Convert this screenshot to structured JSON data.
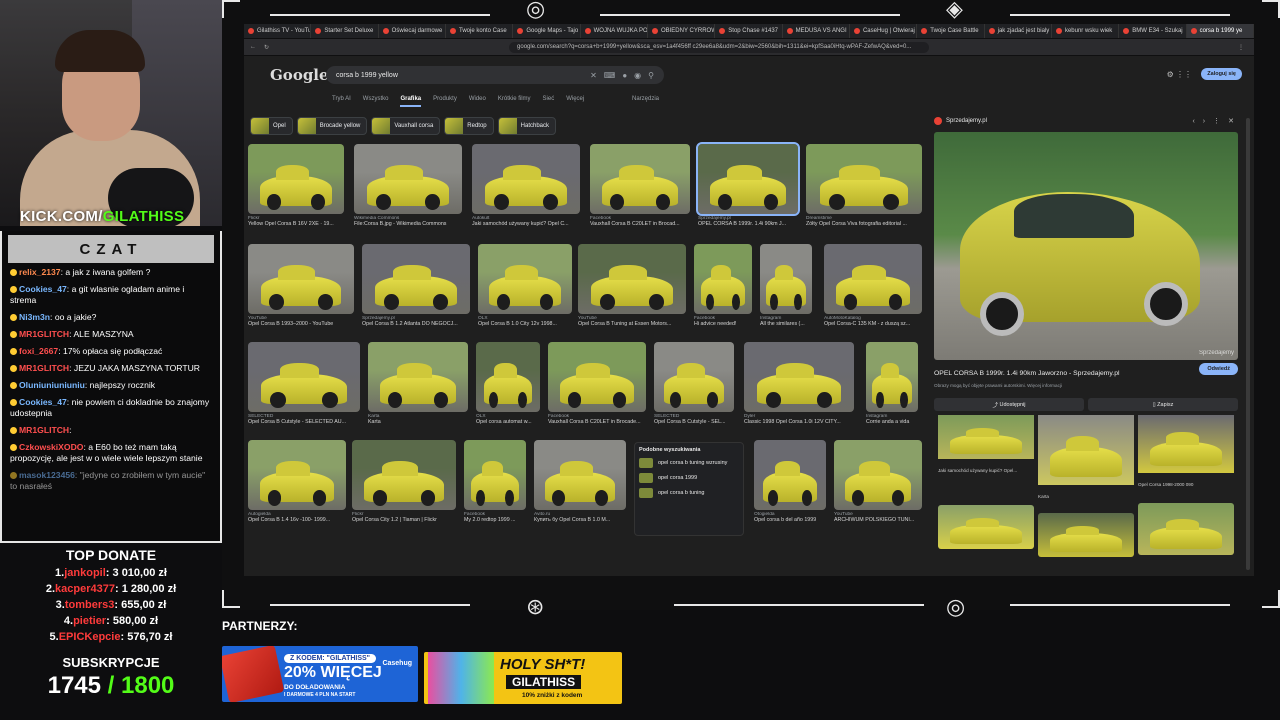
{
  "stream": {
    "kick_prefix": "KICK.COM/",
    "kick_user": "GILATHISS"
  },
  "chat": {
    "title": "CZAT",
    "messages": [
      {
        "user": "relix_2137",
        "text": "a jak z iwana golfem ?",
        "color": "b"
      },
      {
        "user": "Cookies_47",
        "text": "a git wlasnie ogladam anime i strema",
        "color": "u"
      },
      {
        "user": "Ni3m3n",
        "text": "oo a jakie?",
        "color": "u"
      },
      {
        "user": "MR1GLITCH",
        "text": "ALE MASZYNA",
        "color": "r"
      },
      {
        "user": "foxi_2667",
        "text": "17% opłaca się podłączać",
        "color": "r"
      },
      {
        "user": "MR1GLITCH",
        "text": "JEZU JAKA MASZYNA TORTUR",
        "color": "r"
      },
      {
        "user": "Oluniuniuniuniu",
        "text": "najlepszy rocznik",
        "color": "u"
      },
      {
        "user": "Cookies_47",
        "text": "nie powiem ci dokladnie bo znajomy udostepnia",
        "color": "u"
      },
      {
        "user": "MR1GLITCH",
        "text": "",
        "color": "r"
      },
      {
        "user": "CzkowskiXODO",
        "text": "a E60 bo też mam taką propozycję, ale jest w o wiele wiele lepszym stanie",
        "color": "r"
      },
      {
        "user": "masok123456",
        "text": "\"jedyne co zrobiłem w tym aucie\" to nasrałeś",
        "color": "u"
      }
    ]
  },
  "donate": {
    "title": "TOP DONATE",
    "items": [
      {
        "rank": "1.",
        "name": "jankopil",
        "amount": "3 010,00 zł"
      },
      {
        "rank": "2.",
        "name": "kacper4377",
        "amount": "1 280,00 zł"
      },
      {
        "rank": "3.",
        "name": "tombers3",
        "amount": "655,00 zł"
      },
      {
        "rank": "4.",
        "name": "pietier",
        "amount": "580,00 zł"
      },
      {
        "rank": "5.",
        "name": "EPICKepcie",
        "amount": "576,70 zł"
      }
    ]
  },
  "subs": {
    "title": "SUBSKRYPCJE",
    "current": "1745",
    "goal": "/ 1800"
  },
  "browser": {
    "tabs": [
      "Gilathiss TV - YouTu",
      "Starter Set Deluxe",
      "Oświecaj darmowe",
      "Twoje konto Case",
      "Google Maps - Tajo",
      "WOJNA WUJKA PO",
      "OBIEDNY CYRROW",
      "Stop Chase #1437",
      "MEDUSA VS ANGI",
      "CaseHug | Otwieraj",
      "Twoje Case Battle",
      "jak zjadać jest bialy",
      "kebunr wsku wiek",
      "BMW E34 - Szukaj",
      "corsa b 1999 ye"
    ],
    "url": "google.com/search?q=corsa+b+1999+yellow&sca_esv=1a4f456ff c29ee6a8&udm=2&biw=2560&bih=1311&ei=kpfSaa0iHtq-wPAF-ZefwAQ&ved=0...",
    "logo": "Google",
    "query": "corsa b 1999 yellow",
    "nav": [
      "Tryb AI",
      "Wszystko",
      "Grafika",
      "Produkty",
      "Wideo",
      "Krótkie filmy",
      "Sieć",
      "Więcej"
    ],
    "tools": "Narzędzia",
    "signin": "Zaloguj się",
    "chips": [
      "Opel",
      "Brocade yellow",
      "Vauxhall corsa",
      "Redtop",
      "Hatchback"
    ]
  },
  "results": [
    [
      {
        "src": "Flickr",
        "cap": "Yellow Opel Corsa B 16V 2XE · 19..."
      },
      {
        "src": "Wikimedia Commons",
        "cap": "File:Corsa B.jpg - Wikimedia Commons"
      },
      {
        "src": "Autokult",
        "cap": "Jaki samochód używany kupić? Opel C..."
      },
      {
        "src": "Facebook",
        "cap": "Vauxhall Corsa B C20LET in Brocad..."
      },
      {
        "src": "Sprzedajemy.pl",
        "cap": "OPEL CORSA B 1999r. 1.4i 90km J..."
      },
      {
        "src": "Dreamstime",
        "cap": "Żółty Opel Corsa Viva fotografia editorial ..."
      }
    ],
    [
      {
        "src": "YouTube",
        "cap": "Opel Corsa B 1993–2000 - YouTube"
      },
      {
        "src": "Sprzedajemy.pl",
        "cap": "Opel Corsa B 1.2 Atlanta DO NEGOCJ..."
      },
      {
        "src": "OLX",
        "cap": "Opel Corsa B 1.0 City 12v 1998..."
      },
      {
        "src": "YouTube",
        "cap": "Opel Corsa B Tuning at Essen Motors..."
      },
      {
        "src": "Facebook",
        "cap": "Hi advice needed!"
      },
      {
        "src": "Instagram",
        "cap": "All the similares (..."
      },
      {
        "src": "AutoMotoKatalog",
        "cap": "Opel Corsa-C 135 KM - z duszą sz..."
      }
    ],
    [
      {
        "src": "SELECTED",
        "cap": "Opel Corsa B Cutstyle - SELECTED AU..."
      },
      {
        "src": "Karta",
        "cap": "Karta"
      },
      {
        "src": "OLX",
        "cap": "Opel corsa automat w..."
      },
      {
        "src": "Facebook",
        "cap": "Vauxhall Corsa B C20LET in Brocade..."
      },
      {
        "src": "SELECTED",
        "cap": "Opel Corsa B Cutstyle - SEL..."
      },
      {
        "src": "Dyler",
        "cap": "Classic 1998 Opel Corsa 1.0i 12V CITY..."
      },
      {
        "src": "Instagram",
        "cap": "Corrie anda a vida"
      }
    ],
    [
      {
        "src": "Autogielda",
        "cap": "Opel Corsa B 1.4 16v -100- 1999..."
      },
      {
        "src": "Flickr",
        "cap": "Opel Corsa City 1.2 | Tiaman | Flickr"
      },
      {
        "src": "Facebook",
        "cap": "My 2.0 redtop 1999 ..."
      },
      {
        "src": "Avito.ru",
        "cap": "Купить бу Opel Corsa B 1.0 M..."
      },
      {
        "src": "Otogielda",
        "cap": "Opel corsa b del año 1999"
      },
      {
        "src": "YouTube",
        "cap": "ARCHIWUM POLSKIEGO TUNI..."
      }
    ]
  ],
  "similar": {
    "title": "Podobne wyszukiwania",
    "items": [
      "opel corsa b tuning wzrusiny",
      "opel corsa 1999",
      "opel corsa b tuning"
    ]
  },
  "panel": {
    "site": "Sprzedajemy.pl",
    "watermark": "Sprzedajemy",
    "title": "OPEL CORSA B 1999r. 1.4i 90km Jaworzno - Sprzedajemy.pl",
    "sub": "Obrazy mogą być objęte prawami autorskimi. Więcej informacji",
    "visit": "Odwiedź",
    "share": "Udostępnij",
    "save": "Zapisz",
    "related": [
      {
        "cap": "Jaki samochód używany kupić? Opel..."
      },
      {
        "cap": "Karta"
      },
      {
        "cap": "Opel Corsa 1998-2000 090"
      }
    ]
  },
  "partners": {
    "label": "PARTNERZY:"
  },
  "banner1": {
    "code": "Z KODEM: \"GILATHISS\"",
    "big": "20% WIĘCEJ",
    "sub": "DO DOŁADOWANIA",
    "sub2": "I DARMOWE 4 PLN NA START",
    "brand": "Casehug"
  },
  "banner2": {
    "big": "HOLY SH*T!",
    "mid": "GILATHISS",
    "sm": "10% zniżki z kodem"
  }
}
